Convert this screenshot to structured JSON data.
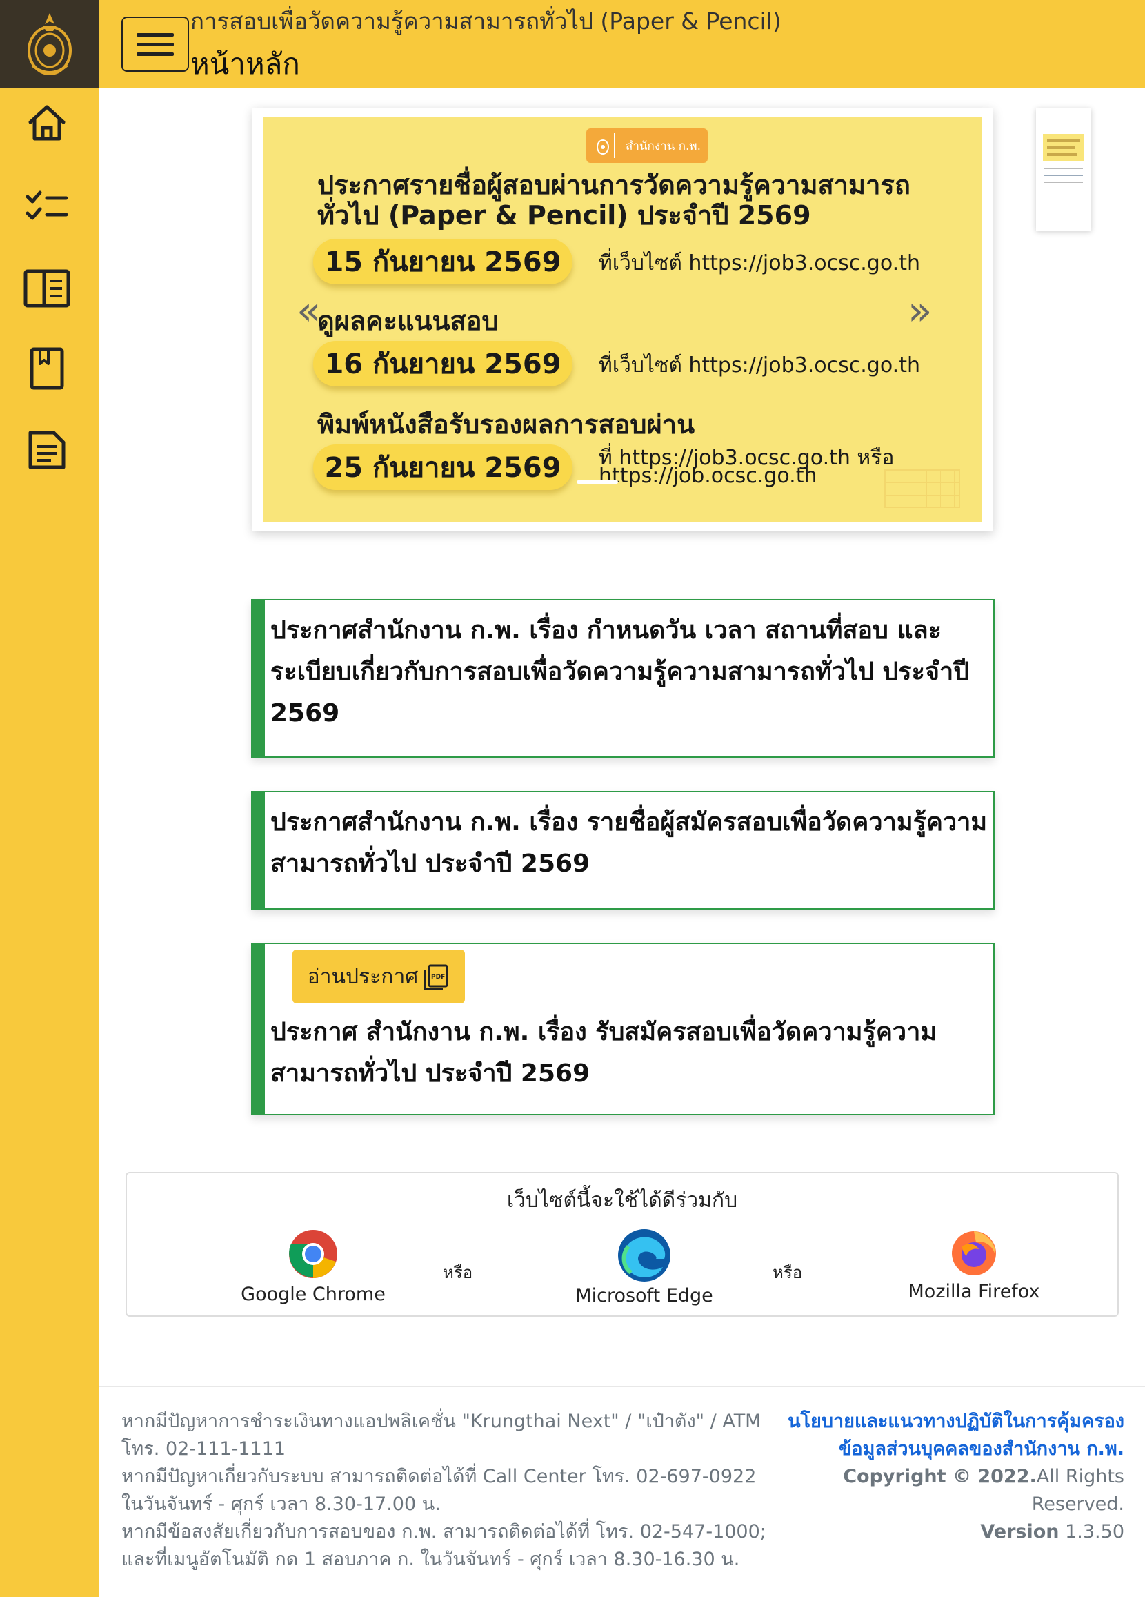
{
  "header": {
    "subtitle": "การสอบเพื่อวัดความรู้ความสามารถทั่วไป (Paper & Pencil)",
    "title": "หน้าหลัก"
  },
  "sidebar": {
    "items": [
      {
        "icon": "home-icon"
      },
      {
        "icon": "checklist-icon"
      },
      {
        "icon": "book-open-icon"
      },
      {
        "icon": "bookmark-book-icon"
      },
      {
        "icon": "document-icon"
      }
    ]
  },
  "carousel": {
    "badge": "สำนักงาน ก.พ.",
    "heading": "ประกาศรายชื่อผู้สอบผ่านการวัดความรู้ความสามารถทั่วไป (Paper & Pencil) ประจำปี 2569",
    "date1": "15 กันยายน 2569",
    "site1": "ที่เว็บไซต์ https://job3.ocsc.go.th",
    "sub2": "ดูผลคะแนนสอบ",
    "date2": "16 กันยายน 2569",
    "site2": "ที่เว็บไซต์ https://job3.ocsc.go.th",
    "sub3": "พิมพ์หนังสือรับรองผลการสอบผ่าน",
    "date3": "25 กันยายน 2569",
    "site3a": "ที่ https://job3.ocsc.go.th หรือ",
    "site3b": "https://job.ocsc.go.th",
    "prev": "«",
    "next": "»"
  },
  "announcements": [
    {
      "text": "ประกาศสำนักงาน ก.พ. เรื่อง กำหนดวัน เวลา สถานที่สอบ และระเบียบเกี่ยวกับการสอบเพื่อวัดความรู้ความสามารถทั่วไป ประจำปี 2569"
    },
    {
      "text": "ประกาศสำนักงาน ก.พ. เรื่อง รายชื่อผู้สมัครสอบเพื่อวัดความรู้ความสามารถทั่วไป ประจำปี 2569"
    },
    {
      "text": "ประกาศ สำนักงาน ก.พ. เรื่อง รับสมัครสอบเพื่อวัดความรู้ความสามารถทั่วไป ประจำปี 2569",
      "button": "อ่านประกาศ"
    }
  ],
  "browsers": {
    "heading": "เว็บไซต์นี้จะใช้ได้ดีร่วมกับ",
    "or": "หรือ",
    "items": [
      "Google Chrome",
      "Microsoft Edge",
      "Mozilla Firefox"
    ]
  },
  "footer": {
    "line1": "หากมีปัญหาการชำระเงินทางแอปพลิเคชั่น \"Krungthai Next\" / \"เป๋าตัง\" / ATM โทร. 02-111-1111",
    "line2": "หากมีปัญหาเกี่ยวกับระบบ สามารถติดต่อได้ที่ Call Center โทร. 02-697-0922 ในวันจันทร์ - ศุกร์ เวลา 8.30-17.00 น.",
    "line3": "หากมีข้อสงสัยเกี่ยวกับการสอบของ ก.พ. สามารถติดต่อได้ที่ โทร. 02-547-1000; และที่เมนูอัตโนมัติ กด 1 สอบภาค ก. ในวันจันทร์ - ศุกร์ เวลา 8.30-16.30 น.",
    "policy": "นโยบายและแนวทางปฏิบัติในการคุ้มครองข้อมูลส่วนบุคคลของสำนักงาน ก.พ.",
    "copyright_strong": "Copyright © 2022.",
    "copyright_rest": "All Rights Reserved.",
    "version_label": "Version",
    "version_value": " 1.3.50"
  },
  "colors": {
    "accent": "#f8c93c",
    "logo_bg": "#3a3326",
    "announcement_border": "#2e9b47",
    "link": "#1565d8"
  }
}
